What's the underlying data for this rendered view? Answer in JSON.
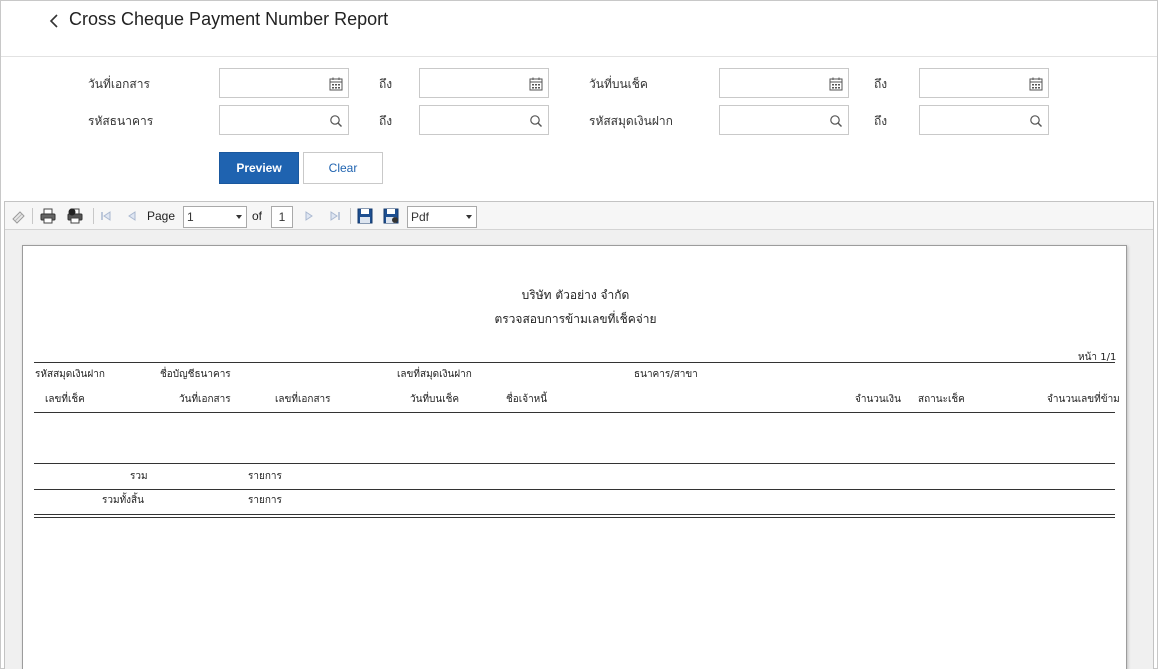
{
  "header": {
    "title": "Cross Cheque Payment Number Report"
  },
  "filters": {
    "doc_date_label": "วันที่เอกสาร",
    "doc_date_to_label": "ถึง",
    "cheque_date_label": "วันที่บนเช็ค",
    "cheque_date_to_label": "ถึง",
    "bank_code_label": "รหัสธนาคาร",
    "bank_code_to_label": "ถึง",
    "passbook_code_label": "รหัสสมุดเงินฝาก",
    "passbook_code_to_label": "ถึง",
    "doc_date_from": "",
    "doc_date_to": "",
    "cheque_date_from": "",
    "cheque_date_to": "",
    "bank_code_from": "",
    "bank_code_to": "",
    "passbook_code_from": "",
    "passbook_code_to": ""
  },
  "actions": {
    "preview_label": "Preview",
    "clear_label": "Clear"
  },
  "viewer": {
    "page_label": "Page",
    "page_current": "1",
    "of_label": "of",
    "page_total": "1",
    "export_format": "Pdf"
  },
  "report": {
    "company": "บริษัท ตัวอย่าง จำกัด",
    "title": "ตรวจสอบการข้ามเลขที่เช็คจ่าย",
    "page_info": "หน้า 1/1",
    "group_headers": [
      "รหัสสมุดเงินฝาก",
      "ชื่อบัญชีธนาคาร",
      "เลขที่สมุดเงินฝาก",
      "ธนาคาร/สาขา"
    ],
    "columns": [
      "เลขที่เช็ค",
      "วันที่เอกสาร",
      "เลขที่เอกสาร",
      "วันที่บนเช็ค",
      "ชื่อเจ้าหนี้",
      "จำนวนเงิน",
      "สถานะเช็ค",
      "จำนวนเลขที่ข้าม"
    ],
    "subtotal_label": "รวม",
    "subtotal_unit": "รายการ",
    "total_label": "รวมทั้งสิ้น",
    "total_unit": "รายการ"
  },
  "colors": {
    "accent": "#1f63b0"
  }
}
